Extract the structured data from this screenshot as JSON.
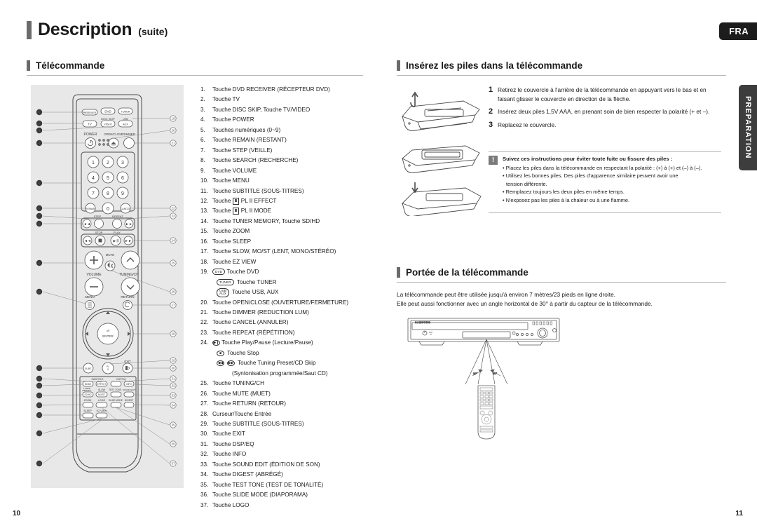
{
  "header": {
    "title": "Description",
    "subtitle": "(suite)",
    "lang_tab": "FRA",
    "side_tab": "PREPARATION"
  },
  "sections": {
    "remote": {
      "heading": "Télécommande"
    },
    "batteries": {
      "heading": "Insérez les piles dans la télécommande"
    },
    "range": {
      "heading": "Portée de la télécommande"
    }
  },
  "button_list": [
    {
      "n": "1.",
      "text": "Touche DVD RECEIVER (RÉCEPTEUR DVD)"
    },
    {
      "n": "2.",
      "text": "Touche TV"
    },
    {
      "n": "3.",
      "text": "Touche DISC SKIP, Touche TV/VIDEO"
    },
    {
      "n": "4.",
      "text": "Touche POWER"
    },
    {
      "n": "5.",
      "text": "Touches numériques (0~9)"
    },
    {
      "n": "6.",
      "text": "Touche REMAIN (RESTANT)"
    },
    {
      "n": "7.",
      "text": "Touche STEP (VEILLE)"
    },
    {
      "n": "8.",
      "text": "Touche SEARCH (RECHERCHE)"
    },
    {
      "n": "9.",
      "text": "Touche VOLUME"
    },
    {
      "n": "10.",
      "text": "Touche MENU"
    },
    {
      "n": "11.",
      "text": "Touche SUBTITLE (SOUS-TITRES)"
    },
    {
      "n": "12.",
      "text": "Touche",
      "icon": "plii",
      "text2": "PL II EFFECT"
    },
    {
      "n": "13.",
      "text": "Touche",
      "icon": "plii",
      "text2": "PL II MODE"
    },
    {
      "n": "14.",
      "text": "Touche TUNER MEMORY, Touche SD/HD"
    },
    {
      "n": "15.",
      "text": "Touche ZOOM"
    },
    {
      "n": "16.",
      "text": "Touche SLEEP"
    },
    {
      "n": "17.",
      "text": "Touche SLOW, MO/ST (LENT, MONO/STÉRÉO)"
    },
    {
      "n": "18.",
      "text": "Touche EZ VIEW"
    },
    {
      "n": "19.",
      "icon": "dvd-key",
      "key": "DVD",
      "text2": "Touche DVD"
    },
    {
      "n": "",
      "icon": "tuner-key",
      "key": "TUNER",
      "text2": "Touche TUNER",
      "sub": true
    },
    {
      "n": "",
      "icon": "usbaux-key",
      "key": "USB AUX",
      "text2": "Touche USB, AUX",
      "sub": true
    },
    {
      "n": "20.",
      "text": "Touche OPEN/CLOSE (OUVERTURE/FERMETURE)"
    },
    {
      "n": "21.",
      "text": "Touche DIMMER (REDUCTION LUM)"
    },
    {
      "n": "22.",
      "text": "Touche CANCEL (ANNULER)"
    },
    {
      "n": "23.",
      "text": "Touche REPEAT (RÉPÉTITION)"
    },
    {
      "n": "24.",
      "icon": "play-pause",
      "text2": "Touche Play/Pause (Lecture/Pause)"
    },
    {
      "n": "",
      "icon": "stop",
      "text2": "Touche Stop",
      "sub": true
    },
    {
      "n": "",
      "icon": "skip-pair",
      "text2": "Touche Tuning Preset/CD Skip",
      "sub": true
    },
    {
      "n": "",
      "text2": "(Syntonisation programmée/Saut CD)",
      "sub2": true
    },
    {
      "n": "25.",
      "text": "Touche TUNING/CH"
    },
    {
      "n": "26.",
      "text": "Touche MUTE (MUET)"
    },
    {
      "n": "27.",
      "text": "Touche RETURN (RETOUR)"
    },
    {
      "n": "28.",
      "text": "Curseur/Touche Entrée"
    },
    {
      "n": "29.",
      "text": "Touche SUBTITLE (SOUS-TITRES)"
    },
    {
      "n": "30.",
      "text": "Touche EXIT"
    },
    {
      "n": "31.",
      "text": "Touche DSP/EQ"
    },
    {
      "n": "32.",
      "text": "Touche INFO"
    },
    {
      "n": "33.",
      "text": "Touche SOUND EDIT (ÉDITION DE SON)"
    },
    {
      "n": "34.",
      "text": "Touche DIGEST (ABRÉGÉ)"
    },
    {
      "n": "35.",
      "text": "Touche TEST TONE (TEST DE TONALITÉ)"
    },
    {
      "n": "36.",
      "text": "Touche SLIDE MODE (DIAPORAMA)"
    },
    {
      "n": "37.",
      "text": "Touche LOGO"
    }
  ],
  "battery_steps": [
    {
      "n": "1",
      "text": "Retirez le couvercle à l'arrière de la télécommande en appuyant vers le bas et en faisant glisser le couvercle en direction de la flèche."
    },
    {
      "n": "2",
      "text": "Insérez deux piles 1,5V AAA, en prenant soin de bien respecter la polarité (+ et –)."
    },
    {
      "n": "3",
      "text": "Replacez le couvercle."
    }
  ],
  "caution": {
    "icon": "!",
    "title": "Suivez ces instructions pour éviter toute fuite ou fissure des piles  :",
    "bullets": [
      "• Placez les piles dans la télécommande en respectant la polarité : (+) à (+) et (–) à (–).",
      "• Utilisez les bonnes piles. Des piles d'apparence similaire peuvent avoir une",
      "tension différente.",
      "• Remplacez toujours les deux piles en même temps.",
      "• N'exposez pas les piles à la chaleur ou à une flamme."
    ]
  },
  "range": {
    "line1": "La télécommande peut être utilisée jusqu'à environ 7 mètres/23 pieds en ligne droite.",
    "line2": "Elle peut aussi fonctionner avec un angle horizontal de 30° à partir du capteur de la télécommande.",
    "angle_left": "30°",
    "angle_right": "30°",
    "brand": "SAMSUNG"
  },
  "remote_labels": {
    "power": "POWER",
    "disc_skip": "DISC SKIP",
    "open_close": "OPEN/CLOSE",
    "dimmer": "DIMMER",
    "dvd": "DVD",
    "tuner": "TUNER",
    "tv": "TV",
    "video": "VIDEO",
    "usb": "USB",
    "aux": "AUX",
    "receiver": "RECEIVER",
    "remain": "REMAIN",
    "cancel": "CANCEL",
    "step": "STEP",
    "repeat": "REPEAT",
    "stop": "STOP",
    "play": "PLAY",
    "volume": "VOLUME",
    "mute": "MUTE",
    "tuning_ch": "TUNING/CH",
    "menu": "MENU",
    "return": "RETURN",
    "enter": "ENTER",
    "subtitle": "SUBT.",
    "pl2": "PL II",
    "exit": "EXIT",
    "dsp_eq": "DSP/EQ",
    "info": "INFO",
    "mode": "MODE",
    "effect": "EFFECT",
    "test_tone": "TEST TONE",
    "sound_edit": "SOUND EDIT",
    "tuner_memory": "TUNER MEMORY",
    "slow": "SLOW",
    "sd_hd": "SD/HD",
    "mo_st": "MO/ST",
    "digest": "DIGEST",
    "zoom": "ZOOM",
    "logo": "LOGO",
    "slide_mode": "SLIDE MODE",
    "sleep": "SLEEP",
    "ez_view": "EZ VIEW",
    "digits": [
      "1",
      "2",
      "3",
      "4",
      "5",
      "6",
      "7",
      "8",
      "9",
      "0"
    ]
  },
  "footer": {
    "page_left": "10",
    "page_right": "11"
  }
}
